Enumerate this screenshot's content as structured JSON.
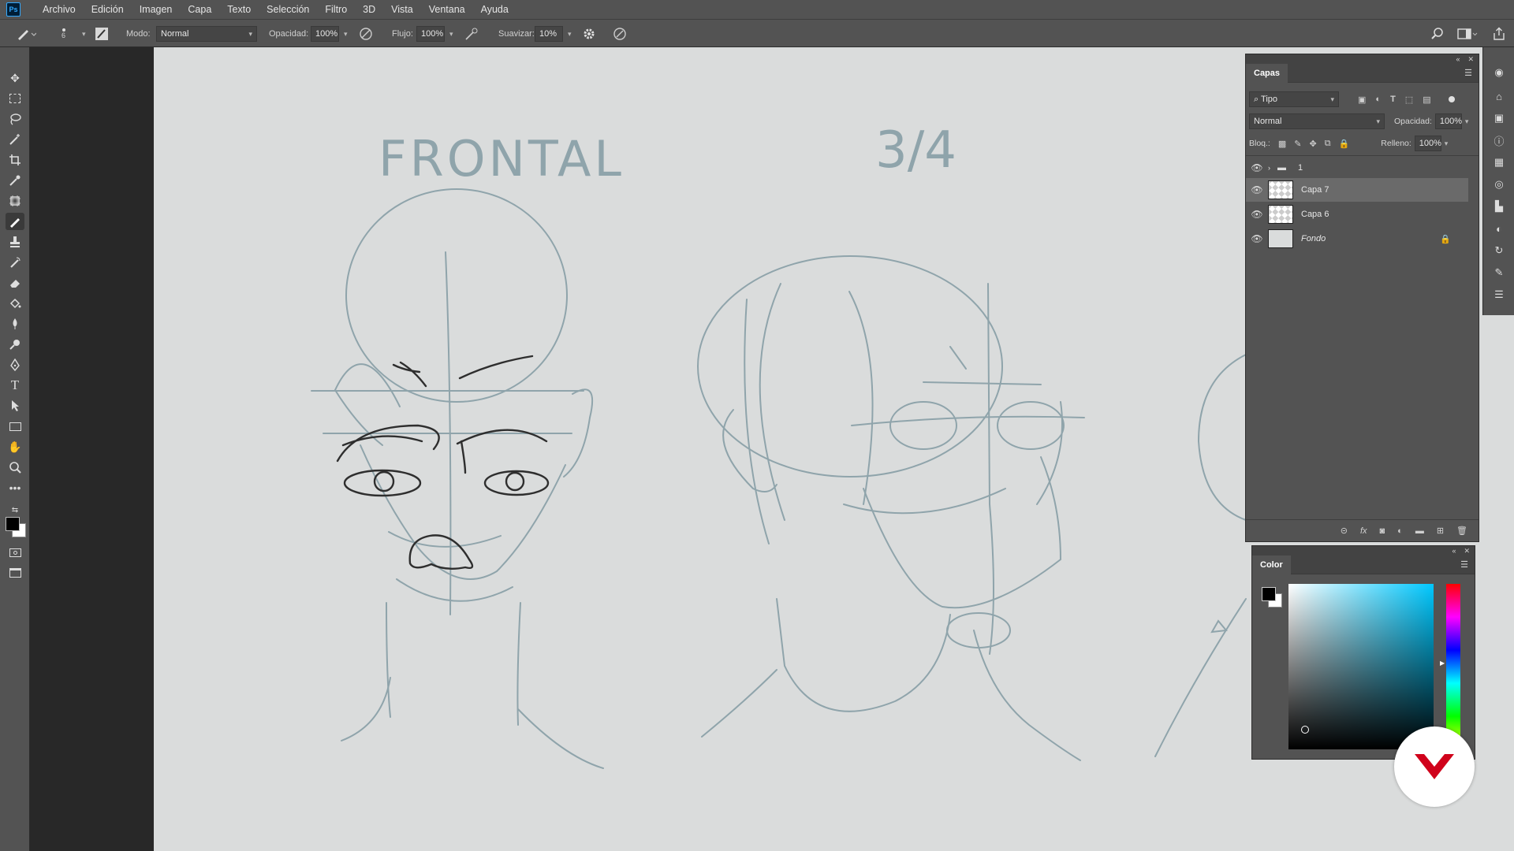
{
  "app": {
    "logo": "Ps"
  },
  "menu": [
    "Archivo",
    "Edición",
    "Imagen",
    "Capa",
    "Texto",
    "Selección",
    "Filtro",
    "3D",
    "Vista",
    "Ventana",
    "Ayuda"
  ],
  "options": {
    "brush_size": "6",
    "mode_label": "Modo:",
    "mode_value": "Normal",
    "opacity_label": "Opacidad:",
    "opacity_value": "100%",
    "flow_label": "Flujo:",
    "flow_value": "100%",
    "smooth_label": "Suavizar:",
    "smooth_value": "10%"
  },
  "canvas": {
    "label_front": "FRONTAL",
    "label_three_quarter": "3/4"
  },
  "layers_panel": {
    "tab": "Capas",
    "filter_kind": "Tipo",
    "blend_mode": "Normal",
    "opacity_label": "Opacidad:",
    "opacity_value": "100%",
    "lock_label": "Bloq.:",
    "fill_label": "Relleno:",
    "fill_value": "100%",
    "layers": [
      {
        "name": "1",
        "type": "group",
        "visible": true,
        "selected": false
      },
      {
        "name": "Capa 7",
        "type": "layer",
        "visible": true,
        "selected": true
      },
      {
        "name": "Capa 6",
        "type": "layer",
        "visible": true,
        "selected": false
      },
      {
        "name": "Fondo",
        "type": "background",
        "visible": true,
        "selected": false,
        "locked": true
      }
    ]
  },
  "color_panel": {
    "tab": "Color",
    "hue_color": "#00c8ff",
    "foreground": "#000000",
    "background": "#ffffff"
  },
  "icons": {
    "eye": "eye-icon",
    "folder": "folder-icon",
    "lock": "lock-icon"
  },
  "brand_badge_color": "#d0021b"
}
